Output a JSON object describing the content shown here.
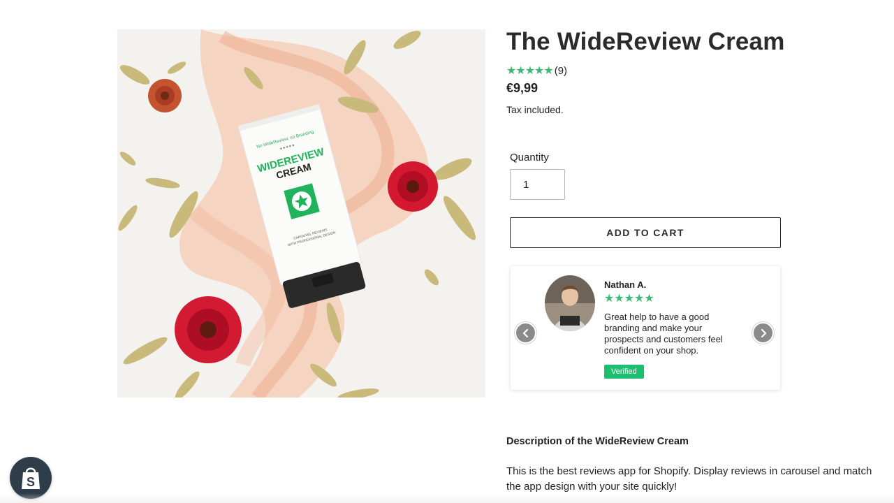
{
  "product": {
    "title": "The WideReview Cream",
    "stars_display": "★★★★★",
    "rating": 5,
    "rating_count": "(9)",
    "price": "€9,99",
    "tax_note": "Tax included.",
    "image": {
      "tube_line1": "No WideReview, no Branding",
      "tube_stars": "★★★★★",
      "tube_brand_line1": "WIDEREVIEW",
      "tube_brand_line2": "CREAM",
      "tube_footer1": "CAROUSEL REVIEWS",
      "tube_footer2": "WITH PROFESSIONAL DESIGN"
    }
  },
  "quantity": {
    "label": "Quantity",
    "value": "1"
  },
  "cart": {
    "add_label": "ADD TO CART"
  },
  "review": {
    "name": "Nathan A.",
    "stars_display": "★★★★★",
    "rating": 5,
    "text": "Great help to have a good branding and make your prospects and customers feel confident on your shop.",
    "badge": "Verified",
    "prev_icon": "chevron-left-icon",
    "next_icon": "chevron-right-icon"
  },
  "description": {
    "heading": "Description of the WideReview Cream",
    "body": "This is the best reviews app for Shopify. Display reviews in carousel and match the app design with your site quickly!"
  },
  "shopify_badge": {
    "icon": "shopify-bag-icon",
    "letter": "S"
  },
  "colors": {
    "star_green": "#3cb878",
    "verified_green": "#1dc070",
    "text_dark": "#222222",
    "badge_bg": "#2f3d4a"
  }
}
